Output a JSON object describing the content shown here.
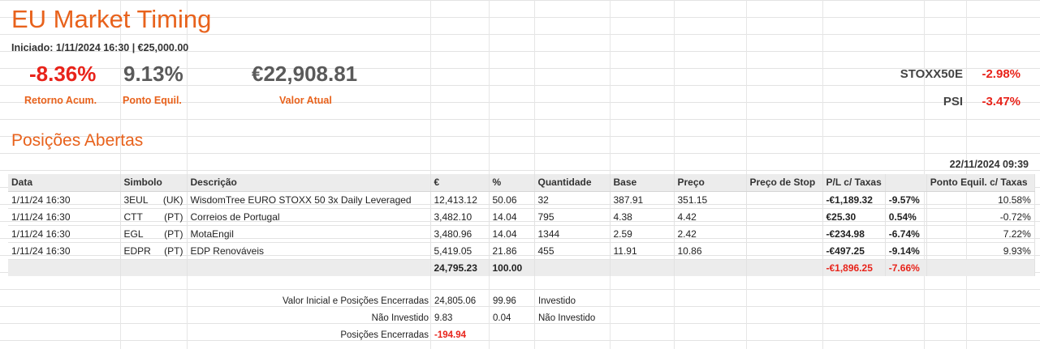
{
  "header": {
    "title": "EU Market Timing",
    "subtitle": "Iniciado: 1/11/2024 16:30 |  €25,000.00"
  },
  "kpis": [
    {
      "value": "-8.36%",
      "label": "Retorno Acum.",
      "color": "#e8231a"
    },
    {
      "value": "9.13%",
      "label": "Ponto Equil.",
      "color": "#5a5a5a"
    },
    {
      "value": "€22,908.81",
      "label": "Valor Atual",
      "color": "#5a5a5a"
    }
  ],
  "indices": [
    {
      "name": "STOXX50E",
      "value": "-2.98%"
    },
    {
      "name": "PSI",
      "value": "-3.47%"
    }
  ],
  "positions": {
    "title": "Posições Abertas",
    "timestamp": "22/11/2024 09:39",
    "columns": [
      "Data",
      "Simbolo",
      "Descrição",
      "€",
      "%",
      "Quantidade",
      "Base",
      "Preço",
      "Preço de Stop",
      "P/L c/ Taxas",
      "",
      "Ponto Equil. c/ Taxas"
    ],
    "rows": [
      {
        "date": "1/11/24 16:30",
        "symbol": "3EUL",
        "market": "(UK)",
        "desc": "WisdomTree EURO STOXX 50 3x Daily Leveraged",
        "eur": "12,413.12",
        "pct": "50.06",
        "qty": "32",
        "base": "387.91",
        "price": "351.15",
        "stop": "",
        "pl": "-€1,189.32",
        "plpct": "-9.57%",
        "be": "10.58%",
        "plcolor": "neg"
      },
      {
        "date": "1/11/24 16:30",
        "symbol": "CTT",
        "market": "(PT)",
        "desc": "Correios de Portugal",
        "eur": "3,482.10",
        "pct": "14.04",
        "qty": "795",
        "base": "4.38",
        "price": "4.42",
        "stop": "",
        "pl": "€25.30",
        "plpct": "0.54%",
        "be": "-0.72%",
        "plcolor": "pos"
      },
      {
        "date": "1/11/24 16:30",
        "symbol": "EGL",
        "market": "(PT)",
        "desc": "MotaEngil",
        "eur": "3,480.96",
        "pct": "14.04",
        "qty": "1344",
        "base": "2.59",
        "price": "2.42",
        "stop": "",
        "pl": "-€234.98",
        "plpct": "-6.74%",
        "be": "7.22%",
        "plcolor": "neg"
      },
      {
        "date": "1/11/24 16:30",
        "symbol": "EDPR",
        "market": "(PT)",
        "desc": "EDP Renováveis",
        "eur": "5,419.05",
        "pct": "21.86",
        "qty": "455",
        "base": "11.91",
        "price": "10.86",
        "stop": "",
        "pl": "-€497.25",
        "plpct": "-9.14%",
        "be": "9.93%",
        "plcolor": "neg"
      }
    ],
    "totals": {
      "eur": "24,795.23",
      "pct": "100.00",
      "pl": "-€1,896.25",
      "plpct": "-7.66%"
    }
  },
  "summary": [
    {
      "label": "Valor Inicial e Posições Encerradas",
      "value": "24,805.06",
      "pct": "99.96",
      "note": "Investido",
      "neg": false
    },
    {
      "label": "Não Investido",
      "value": "9.83",
      "pct": "0.04",
      "note": "Não Investido",
      "neg": false
    },
    {
      "label": "Posições Encerradas",
      "value": "-194.94",
      "pct": "",
      "note": "",
      "neg": true
    }
  ]
}
